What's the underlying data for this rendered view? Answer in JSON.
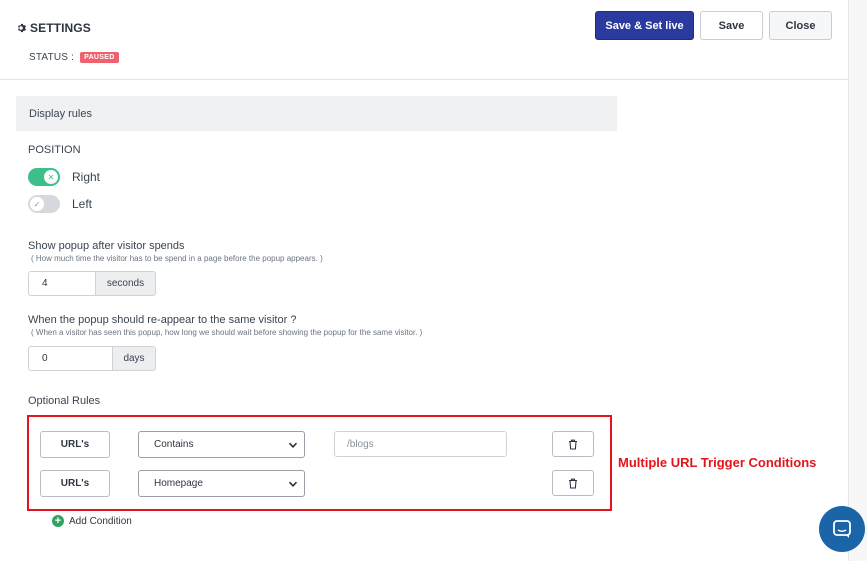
{
  "header": {
    "title": "SETTINGS",
    "status_label": "STATUS :",
    "status_badge": "PAUSED",
    "buttons": {
      "save_set_live": "Save & Set live",
      "save": "Save",
      "close": "Close"
    }
  },
  "display_rules": {
    "section_title": "Display rules",
    "position_label": "POSITION",
    "positions": [
      {
        "label": "Right",
        "enabled": true
      },
      {
        "label": "Left",
        "enabled": false
      }
    ],
    "delay": {
      "label": "Show popup after visitor spends",
      "hint": "( How much time the visitor has to be spend in a page before the popup appears. )",
      "value": "4",
      "unit": "seconds"
    },
    "reappear": {
      "label": "When the popup should re-appear to the same visitor ?",
      "hint": "( When a visitor has seen this popup, how long we should wait before showing the popup for the same visitor. )",
      "value": "0",
      "unit": "days"
    }
  },
  "optional_rules": {
    "title": "Optional Rules",
    "rows": [
      {
        "type": "URL's",
        "condition": "Contains",
        "value": "/blogs"
      },
      {
        "type": "URL's",
        "condition": "Homepage"
      }
    ],
    "add_condition": "Add Condition"
  },
  "annotation": {
    "text": "Multiple URL Trigger Conditions",
    "color": "#e3141c"
  },
  "colors": {
    "primary": "#2a3a9e",
    "toggle_on": "#3dbf8a",
    "badge": "#f0616f",
    "chat": "#1a64a8"
  }
}
